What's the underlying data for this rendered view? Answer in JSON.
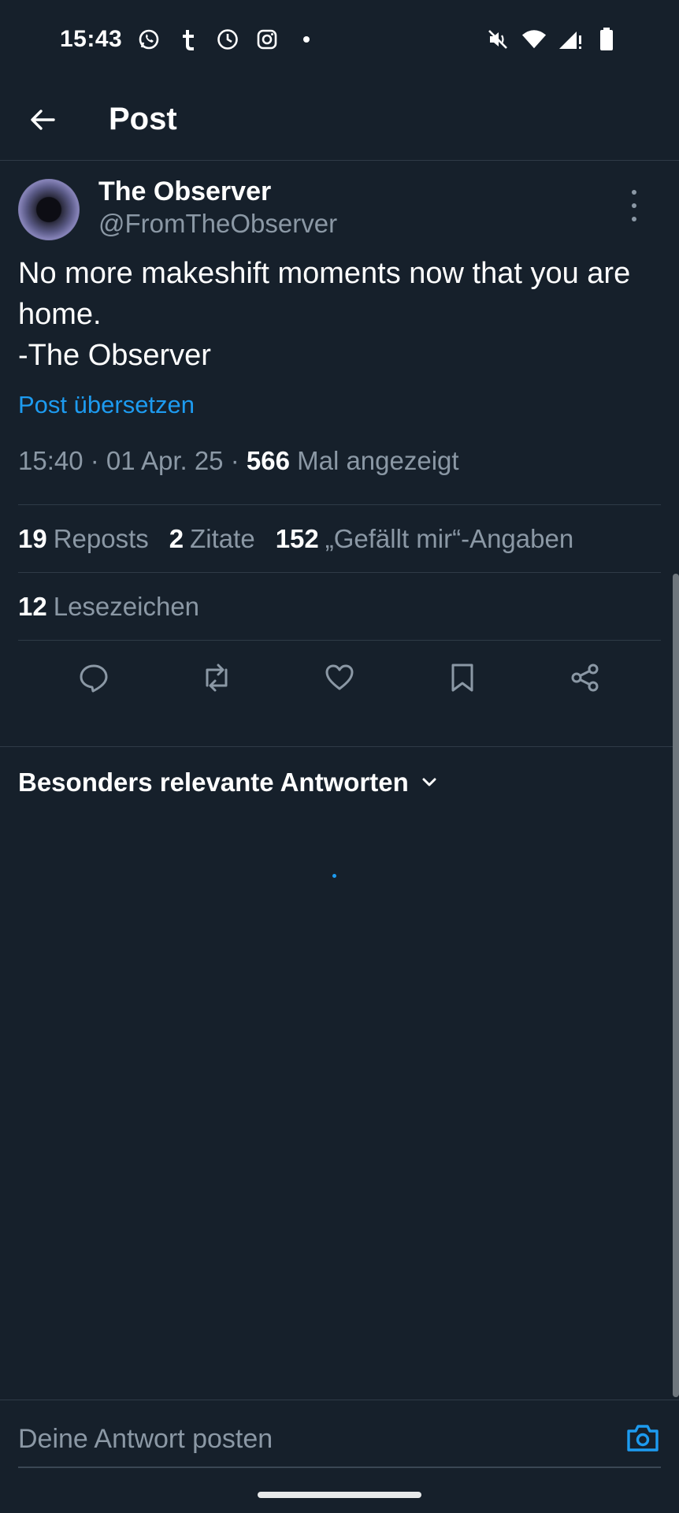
{
  "status_bar": {
    "time": "15:43",
    "left_icons": [
      "whatsapp-icon",
      "tumblr-icon",
      "clock-icon",
      "instagram-icon",
      "dot-icon"
    ],
    "right_icons": [
      "mute-icon",
      "wifi-icon",
      "signal-icon",
      "battery-icon"
    ]
  },
  "header": {
    "title": "Post"
  },
  "post": {
    "author_name": "The Observer",
    "author_handle": "@FromTheObserver",
    "text_line1": "No more makeshift moments now that you are home.",
    "text_signature": "-The Observer",
    "translate_label": "Post übersetzen",
    "meta_prefix": "15:40 · 01 Apr. 25 · ",
    "views_count": "566",
    "views_label": " Mal angezeigt"
  },
  "stats": {
    "reposts_count": "19",
    "reposts_label": "Reposts",
    "quotes_count": "2",
    "quotes_label": "Zitate",
    "likes_count": "152",
    "likes_label": "„Gefällt mir“-Angaben",
    "bookmarks_count": "12",
    "bookmarks_label": "Lesezeichen"
  },
  "actions": [
    "reply-icon",
    "repost-icon",
    "like-icon",
    "bookmark-icon",
    "share-icon"
  ],
  "replies": {
    "sort_label": "Besonders relevante Antworten"
  },
  "composer": {
    "placeholder": "Deine Antwort posten"
  },
  "colors": {
    "background": "#16202b",
    "accent": "#1d9bf0",
    "secondary_text": "#8b98a5",
    "divider": "#2f3b47"
  }
}
